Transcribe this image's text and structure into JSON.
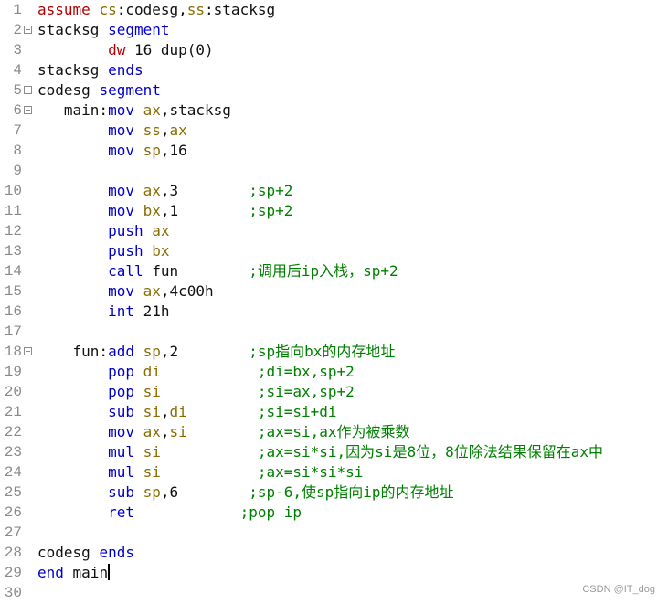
{
  "editor": {
    "lines": [
      {
        "num": "1",
        "fold": false,
        "tokens": [
          {
            "t": "assume ",
            "c": "kw"
          },
          {
            "t": "cs",
            "c": "reg"
          },
          {
            "t": ":codesg,",
            "c": "plain"
          },
          {
            "t": "ss",
            "c": "reg"
          },
          {
            "t": ":stacksg",
            "c": "plain"
          }
        ]
      },
      {
        "num": "2",
        "fold": true,
        "tokens": [
          {
            "t": "stacksg ",
            "c": "plain"
          },
          {
            "t": "segment",
            "c": "op"
          }
        ]
      },
      {
        "num": "3",
        "fold": false,
        "tokens": [
          {
            "t": "        ",
            "c": "plain"
          },
          {
            "t": "dw",
            "c": "kw"
          },
          {
            "t": " 16 dup(0)",
            "c": "plain"
          }
        ]
      },
      {
        "num": "4",
        "fold": false,
        "tokens": [
          {
            "t": "stacksg ",
            "c": "plain"
          },
          {
            "t": "ends",
            "c": "op"
          }
        ]
      },
      {
        "num": "5",
        "fold": true,
        "tokens": [
          {
            "t": "codesg ",
            "c": "plain"
          },
          {
            "t": "segment",
            "c": "op"
          }
        ]
      },
      {
        "num": "6",
        "fold": true,
        "tokens": [
          {
            "t": "   main:",
            "c": "plain"
          },
          {
            "t": "mov",
            "c": "op"
          },
          {
            "t": " ",
            "c": "plain"
          },
          {
            "t": "ax",
            "c": "reg"
          },
          {
            "t": ",stacksg",
            "c": "plain"
          }
        ]
      },
      {
        "num": "7",
        "fold": false,
        "tokens": [
          {
            "t": "        ",
            "c": "plain"
          },
          {
            "t": "mov",
            "c": "op"
          },
          {
            "t": " ",
            "c": "plain"
          },
          {
            "t": "ss",
            "c": "reg"
          },
          {
            "t": ",",
            "c": "plain"
          },
          {
            "t": "ax",
            "c": "reg"
          }
        ]
      },
      {
        "num": "8",
        "fold": false,
        "tokens": [
          {
            "t": "        ",
            "c": "plain"
          },
          {
            "t": "mov",
            "c": "op"
          },
          {
            "t": " ",
            "c": "plain"
          },
          {
            "t": "sp",
            "c": "reg"
          },
          {
            "t": ",16",
            "c": "plain"
          }
        ]
      },
      {
        "num": "9",
        "fold": false,
        "tokens": []
      },
      {
        "num": "10",
        "fold": false,
        "tokens": [
          {
            "t": "        ",
            "c": "plain"
          },
          {
            "t": "mov",
            "c": "op"
          },
          {
            "t": " ",
            "c": "plain"
          },
          {
            "t": "ax",
            "c": "reg"
          },
          {
            "t": ",3        ",
            "c": "plain"
          },
          {
            "t": ";sp+2",
            "c": "cmt"
          }
        ]
      },
      {
        "num": "11",
        "fold": false,
        "tokens": [
          {
            "t": "        ",
            "c": "plain"
          },
          {
            "t": "mov",
            "c": "op"
          },
          {
            "t": " ",
            "c": "plain"
          },
          {
            "t": "bx",
            "c": "reg"
          },
          {
            "t": ",1        ",
            "c": "plain"
          },
          {
            "t": ";sp+2",
            "c": "cmt"
          }
        ]
      },
      {
        "num": "12",
        "fold": false,
        "tokens": [
          {
            "t": "        ",
            "c": "plain"
          },
          {
            "t": "push",
            "c": "op"
          },
          {
            "t": " ",
            "c": "plain"
          },
          {
            "t": "ax",
            "c": "reg"
          }
        ]
      },
      {
        "num": "13",
        "fold": false,
        "tokens": [
          {
            "t": "        ",
            "c": "plain"
          },
          {
            "t": "push",
            "c": "op"
          },
          {
            "t": " ",
            "c": "plain"
          },
          {
            "t": "bx",
            "c": "reg"
          }
        ]
      },
      {
        "num": "14",
        "fold": false,
        "tokens": [
          {
            "t": "        ",
            "c": "plain"
          },
          {
            "t": "call",
            "c": "op"
          },
          {
            "t": " fun        ",
            "c": "plain"
          },
          {
            "t": ";调用后ip入栈，sp+2",
            "c": "cmt"
          }
        ]
      },
      {
        "num": "15",
        "fold": false,
        "tokens": [
          {
            "t": "        ",
            "c": "plain"
          },
          {
            "t": "mov",
            "c": "op"
          },
          {
            "t": " ",
            "c": "plain"
          },
          {
            "t": "ax",
            "c": "reg"
          },
          {
            "t": ",4c00h",
            "c": "plain"
          }
        ]
      },
      {
        "num": "16",
        "fold": false,
        "tokens": [
          {
            "t": "        ",
            "c": "plain"
          },
          {
            "t": "int",
            "c": "op"
          },
          {
            "t": " 21h",
            "c": "plain"
          }
        ]
      },
      {
        "num": "17",
        "fold": false,
        "tokens": []
      },
      {
        "num": "18",
        "fold": true,
        "tokens": [
          {
            "t": "    fun:",
            "c": "plain"
          },
          {
            "t": "add",
            "c": "op"
          },
          {
            "t": " ",
            "c": "plain"
          },
          {
            "t": "sp",
            "c": "reg"
          },
          {
            "t": ",2        ",
            "c": "plain"
          },
          {
            "t": ";sp指向bx的内存地址",
            "c": "cmt"
          }
        ]
      },
      {
        "num": "19",
        "fold": false,
        "tokens": [
          {
            "t": "        ",
            "c": "plain"
          },
          {
            "t": "pop",
            "c": "op"
          },
          {
            "t": " ",
            "c": "plain"
          },
          {
            "t": "di",
            "c": "reg"
          },
          {
            "t": "           ",
            "c": "plain"
          },
          {
            "t": ";di=bx,sp+2",
            "c": "cmt"
          }
        ]
      },
      {
        "num": "20",
        "fold": false,
        "tokens": [
          {
            "t": "        ",
            "c": "plain"
          },
          {
            "t": "pop",
            "c": "op"
          },
          {
            "t": " ",
            "c": "plain"
          },
          {
            "t": "si",
            "c": "reg"
          },
          {
            "t": "           ",
            "c": "plain"
          },
          {
            "t": ";si=ax,sp+2",
            "c": "cmt"
          }
        ]
      },
      {
        "num": "21",
        "fold": false,
        "tokens": [
          {
            "t": "        ",
            "c": "plain"
          },
          {
            "t": "sub",
            "c": "op"
          },
          {
            "t": " ",
            "c": "plain"
          },
          {
            "t": "si",
            "c": "reg"
          },
          {
            "t": ",",
            "c": "plain"
          },
          {
            "t": "di",
            "c": "reg"
          },
          {
            "t": "        ",
            "c": "plain"
          },
          {
            "t": ";si=si+di",
            "c": "cmt"
          }
        ]
      },
      {
        "num": "22",
        "fold": false,
        "tokens": [
          {
            "t": "        ",
            "c": "plain"
          },
          {
            "t": "mov",
            "c": "op"
          },
          {
            "t": " ",
            "c": "plain"
          },
          {
            "t": "ax",
            "c": "reg"
          },
          {
            "t": ",",
            "c": "plain"
          },
          {
            "t": "si",
            "c": "reg"
          },
          {
            "t": "        ",
            "c": "plain"
          },
          {
            "t": ";ax=si,ax作为被乘数",
            "c": "cmt"
          }
        ]
      },
      {
        "num": "23",
        "fold": false,
        "tokens": [
          {
            "t": "        ",
            "c": "plain"
          },
          {
            "t": "mul",
            "c": "op"
          },
          {
            "t": " ",
            "c": "plain"
          },
          {
            "t": "si",
            "c": "reg"
          },
          {
            "t": "           ",
            "c": "plain"
          },
          {
            "t": ";ax=si*si,因为si是8位，8位除法结果保留在ax中",
            "c": "cmt"
          }
        ]
      },
      {
        "num": "24",
        "fold": false,
        "tokens": [
          {
            "t": "        ",
            "c": "plain"
          },
          {
            "t": "mul",
            "c": "op"
          },
          {
            "t": " ",
            "c": "plain"
          },
          {
            "t": "si",
            "c": "reg"
          },
          {
            "t": "           ",
            "c": "plain"
          },
          {
            "t": ";ax=si*si*si",
            "c": "cmt"
          }
        ]
      },
      {
        "num": "25",
        "fold": false,
        "tokens": [
          {
            "t": "        ",
            "c": "plain"
          },
          {
            "t": "sub",
            "c": "op"
          },
          {
            "t": " ",
            "c": "plain"
          },
          {
            "t": "sp",
            "c": "reg"
          },
          {
            "t": ",6        ",
            "c": "plain"
          },
          {
            "t": ";sp-6,使sp指向ip的内存地址",
            "c": "cmt"
          }
        ]
      },
      {
        "num": "26",
        "fold": false,
        "tokens": [
          {
            "t": "        ",
            "c": "plain"
          },
          {
            "t": "ret",
            "c": "op"
          },
          {
            "t": "            ",
            "c": "plain"
          },
          {
            "t": ";pop ip",
            "c": "cmt"
          }
        ]
      },
      {
        "num": "27",
        "fold": false,
        "tokens": []
      },
      {
        "num": "28",
        "fold": false,
        "tokens": [
          {
            "t": "codesg ",
            "c": "plain"
          },
          {
            "t": "ends",
            "c": "op"
          }
        ]
      },
      {
        "num": "29",
        "fold": false,
        "cursor": true,
        "tokens": [
          {
            "t": "end",
            "c": "op"
          },
          {
            "t": " main",
            "c": "plain"
          }
        ]
      },
      {
        "num": "30",
        "fold": false,
        "tokens": []
      }
    ]
  },
  "watermark": "CSDN @IT_dog"
}
